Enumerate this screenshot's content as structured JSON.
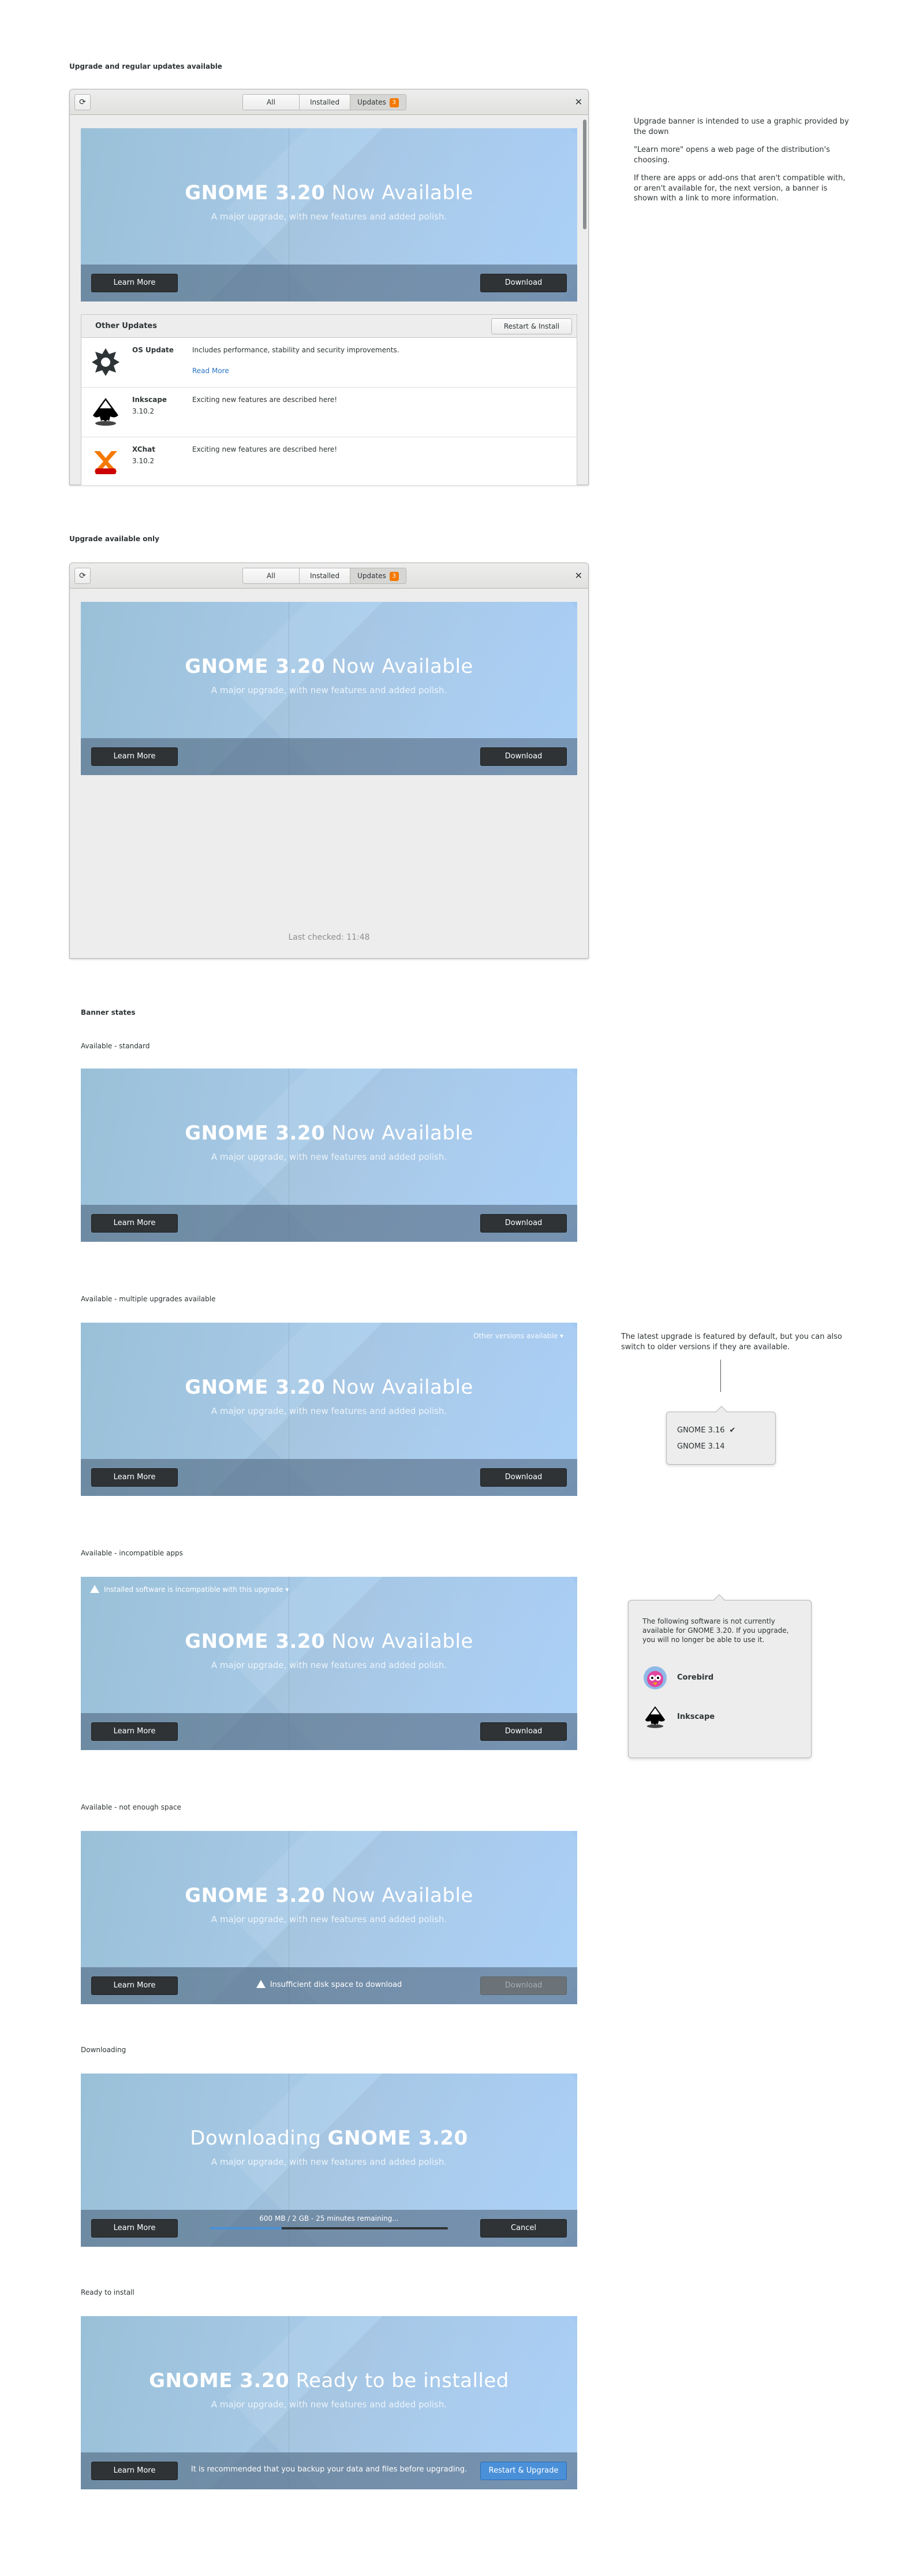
{
  "sections": {
    "regular": "Upgrade and regular updates available",
    "upgrade_only": "Upgrade available only",
    "banner_states": "Banner states"
  },
  "headerbar": {
    "tabs": [
      {
        "label": "All"
      },
      {
        "label": "Installed"
      },
      {
        "label": "Updates",
        "badge": "3"
      }
    ]
  },
  "icons": {
    "refresh": "refresh-icon",
    "close": "close-icon"
  },
  "banner": {
    "title_bold": "GNOME 3.20",
    "title_rest": " Now Available",
    "subtitle": "A major upgrade, with new features and added polish.",
    "learn_more": "Learn More",
    "download": "Download",
    "cancel": "Cancel",
    "restart_upgrade": "Restart & Upgrade",
    "downloading_prefix": "Downloading ",
    "ready_suffix": " Ready to be installed"
  },
  "notes": {
    "p1": "Upgrade banner is intended to use a graphic provided by the down",
    "p2": "\"Learn more\" opens a web page of the distribution's choosing.",
    "p3": "If there are apps or add-ons that aren't compatible with, or aren't available for, the next version, a banner is shown with a link to more information.",
    "latest": "The latest upgrade is featured by default, but you can also switch to older versions if they are available."
  },
  "other_updates": {
    "title": "Other Updates",
    "restart_install": "Restart & Install",
    "rows": [
      {
        "name": "OS Update",
        "version": "",
        "desc": "Includes performance, stability and security improvements.",
        "link": "Read More"
      },
      {
        "name": "Inkscape",
        "version": "3.10.2",
        "desc": "Exciting new features are described here!"
      },
      {
        "name": "XChat",
        "version": "3.10.2",
        "desc": "Exciting new features are described here!"
      }
    ]
  },
  "last_checked": "Last checked: 11:48",
  "states": {
    "standard": "Available - standard",
    "multiple": "Available - multiple upgrades available",
    "incompatible": "Available - incompatible apps",
    "no_space": "Available - not enough space",
    "downloading": "Downloading",
    "ready": "Ready to install"
  },
  "multiple": {
    "other_versions": "Other versions available",
    "versions": [
      {
        "label": "GNOME 3.16",
        "selected": true
      },
      {
        "label": "GNOME 3.14",
        "selected": false
      }
    ]
  },
  "incompatible": {
    "warning": "Installed software is incompatible with this upgrade",
    "popover_text": "The following software is not currently available for GNOME 3.20. If you upgrade, you will no longer be able to use it.",
    "apps": [
      {
        "name": "Corebird"
      },
      {
        "name": "Inkscape"
      }
    ]
  },
  "no_space": {
    "message": "Insufficient disk space to download"
  },
  "downloading": {
    "progress_text": "600 MB / 2 GB - 25 minutes remaining...",
    "progress": 0.3
  },
  "ready": {
    "message": "It is recommended that you backup your data and files before upgrading."
  },
  "colors": {
    "accent": "#4a90d9",
    "badge": "#f57900"
  }
}
